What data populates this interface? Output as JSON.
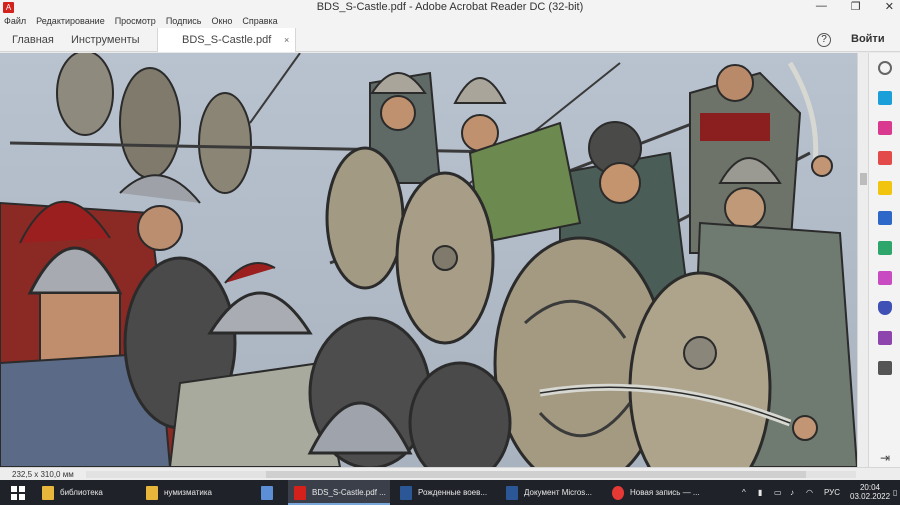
{
  "window": {
    "title": "BDS_S-Castle.pdf - Adobe Acrobat Reader DC (32-bit)",
    "app_icon": "acrobat-icon"
  },
  "menu": [
    "Файл",
    "Редактирование",
    "Просмотр",
    "Подпись",
    "Окно",
    "Справка"
  ],
  "tabs": {
    "home": "Главная",
    "tools": "Инструменты",
    "document": "BDS_S-Castle.pdf",
    "close_glyph": "×"
  },
  "header": {
    "help": "?",
    "signin": "Войти"
  },
  "status": {
    "page_size": "232,5 x 310,0 мм"
  },
  "taskbar": {
    "items": [
      {
        "label": "библиотека",
        "icon": "folder-icon",
        "color": "#e8b63a"
      },
      {
        "label": "нумизматика",
        "icon": "folder-icon",
        "color": "#e8b63a"
      },
      {
        "label": "BDS_S-Castle.pdf ...",
        "icon": "acrobat-icon",
        "color": "#d4211b"
      },
      {
        "label": "Рожденные воев...",
        "icon": "word-icon",
        "color": "#2b5797"
      },
      {
        "label": "Документ Micros...",
        "icon": "word-icon",
        "color": "#2b5797"
      },
      {
        "label": "Новая запись — ...",
        "icon": "yandex-browser-icon",
        "color": "#e53935"
      }
    ],
    "lang": "РУС",
    "time": "20:04",
    "date": "03.02.2022"
  },
  "colors": {
    "accent_red": "#d4211b",
    "taskbar_bg": "#1f2229"
  }
}
